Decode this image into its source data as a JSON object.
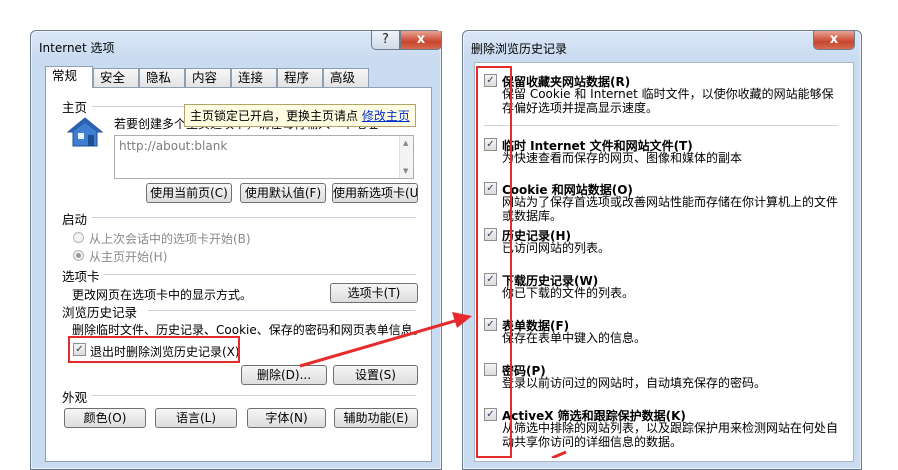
{
  "left_dialog": {
    "title": "Internet 选项",
    "help_glyph": "?",
    "close_glyph": "x",
    "tabs": [
      "常规",
      "安全",
      "隐私",
      "内容",
      "连接",
      "程序",
      "高级"
    ],
    "home": {
      "section_label": "主页",
      "description": "若要创建多个主页选项卡，请在每行输入一个地址",
      "url": "http://about:blank",
      "buttons": [
        "使用当前页(C)",
        "使用默认值(F)",
        "使用新选项卡(U)"
      ]
    },
    "tooltip": {
      "text": "主页锁定已开启，更换主页请点",
      "link": "修改主页"
    },
    "startup": {
      "section_label": "启动",
      "options": [
        "从上次会话中的选项卡开始(B)",
        "从主页开始(H)"
      ]
    },
    "tabs_section": {
      "section_label": "选项卡",
      "description": "更改网页在选项卡中的显示方式。",
      "button": "选项卡(T)"
    },
    "history": {
      "section_label": "浏览历史记录",
      "description": "删除临时文件、历史记录、Cookie、保存的密码和网页表单信息。",
      "checkbox_label": "退出时删除浏览历史记录(X)",
      "delete_button": "删除(D)...",
      "settings_button": "设置(S)"
    },
    "appearance": {
      "section_label": "外观",
      "buttons": [
        "颜色(O)",
        "语言(L)",
        "字体(N)",
        "辅助功能(E)"
      ]
    }
  },
  "right_dialog": {
    "title": "删除浏览历史记录",
    "close_glyph": "x",
    "check_glyph": "✓",
    "items": [
      {
        "title": "保留收藏夹网站数据(R)",
        "description": "保留 Cookie 和 Internet 临时文件，以使你收藏的网站能够保存偏好选项并提高显示速度。",
        "checked": true
      },
      {
        "title": "临时 Internet 文件和网站文件(T)",
        "description": "为快速查看而保存的网页、图像和媒体的副本",
        "checked": true
      },
      {
        "title": "Cookie 和网站数据(O)",
        "description": "网站为了保存首选项或改善网站性能而存储在你计算机上的文件或数据库。",
        "checked": true
      },
      {
        "title": "历史记录(H)",
        "description": "已访问网站的列表。",
        "checked": true
      },
      {
        "title": "下载历史记录(W)",
        "description": "你已下载的文件的列表。",
        "checked": true
      },
      {
        "title": "表单数据(F)",
        "description": "保存在表单中键入的信息。",
        "checked": true
      },
      {
        "title": "密码(P)",
        "description": "登录以前访问过的网站时，自动填充保存的密码。",
        "checked": false
      },
      {
        "title": "ActiveX 筛选和跟踪保护数据(K)",
        "description": "从筛选中排除的网站列表，以及跟踪保护用来检测网站在何处自动共享你访问的详细信息的数据。",
        "checked": true
      }
    ]
  },
  "colors": {
    "annotation_red": "#e52b2b",
    "title_bar": "#c9dbf0",
    "link_blue": "#0033cc"
  }
}
